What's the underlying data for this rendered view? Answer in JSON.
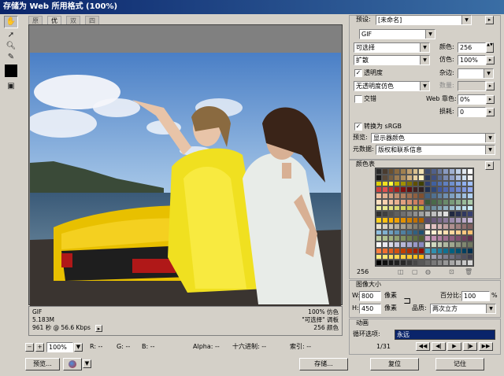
{
  "window": {
    "title": "存储为 Web 所用格式 (100%)"
  },
  "tabs": [
    {
      "label": "原稿"
    },
    {
      "label": "优化"
    },
    {
      "label": "双联"
    },
    {
      "label": "四联"
    }
  ],
  "info_left": {
    "format": "GIF",
    "size": "5.183M",
    "time": "961 秒 @ 56.6 Kbps"
  },
  "info_right": {
    "dither": "100% 仿色",
    "palette": "\"可选择\" 调板",
    "colors": "256 颜色"
  },
  "status": {
    "zoom": "100%",
    "r": "R: --",
    "g": "G: --",
    "b": "B: --",
    "alpha": "Alpha: --",
    "hex": "十六进制: --",
    "index": "索引: --"
  },
  "bottom": {
    "preview": "预览...",
    "save": "存储...",
    "reset": "复位",
    "remember": "记住"
  },
  "settings": {
    "preset_label": "预设:",
    "preset": "[未命名]",
    "format": "GIF",
    "reduction": "可选择",
    "colors_label": "颜色:",
    "colors": "256",
    "dither_algo": "扩散",
    "dither_label": "仿色:",
    "dither": "100%",
    "transparency": "透明度",
    "matte_label": "杂边:",
    "trans_dither": "无透明度仿色",
    "amount_label": "数量:",
    "interlace": "交错",
    "websnap_label": "Web 靠色:",
    "websnap": "0%",
    "lossy_label": "损耗:",
    "lossy": "0",
    "srgb": "转换为 sRGB",
    "preview_label": "预览:",
    "preview": "显示器颜色",
    "metadata_label": "元数据:",
    "metadata": "版权和联系信息"
  },
  "color_table": {
    "title": "颜色表",
    "count": "256"
  },
  "image_size": {
    "title": "图像大小",
    "w_label": "W:",
    "w": "800",
    "h_label": "H:",
    "h": "450",
    "unit": "像素",
    "percent_label": "百分比:",
    "percent": "100",
    "percent_unit": "%",
    "quality_label": "品质:",
    "quality": "两次立方"
  },
  "animation": {
    "title": "动画",
    "loop_label": "循环选项:",
    "loop": "永远",
    "frame": "1/31"
  },
  "palette_colors": [
    "#2a2a2a",
    "#4a3c30",
    "#6a5030",
    "#8a6a40",
    "#a08050",
    "#c0a070",
    "#d8c090",
    "#f0e0b0",
    "#3c4a6a",
    "#50608a",
    "#6a7aa0",
    "#8a9ac0",
    "#a0b0d0",
    "#c0d0e8",
    "#e0e8f0",
    "#ffffff",
    "#1a1a1a",
    "#5a4a3a",
    "#7a6040",
    "#9a7a50",
    "#b09060",
    "#d0b080",
    "#e8d0a0",
    "#fff0c0",
    "#2a3a5a",
    "#405080",
    "#5a6a90",
    "#7a8ab0",
    "#90a0c8",
    "#b0c0e0",
    "#d0e0f0",
    "#f0f0f0",
    "#e0d000",
    "#f0e020",
    "#ffff40",
    "#c8b800",
    "#a09000",
    "#807000",
    "#605000",
    "#404000",
    "#304070",
    "#4060a0",
    "#5070b0",
    "#6080c0",
    "#7090d0",
    "#80a0e0",
    "#90b0f0",
    "#a0c0ff",
    "#d04040",
    "#e05050",
    "#c03030",
    "#a02020",
    "#801010",
    "#601010",
    "#402020",
    "#302020",
    "#203050",
    "#304878",
    "#4058a0",
    "#5068b0",
    "#6078c0",
    "#7088d0",
    "#8098e0",
    "#90a8f0",
    "#f0c0a0",
    "#e0b090",
    "#d0a080",
    "#c09070",
    "#b08060",
    "#a07050",
    "#906040",
    "#805030",
    "#406080",
    "#507090",
    "#6080a0",
    "#7090b0",
    "#80a0c0",
    "#90b0d0",
    "#a0c0e0",
    "#b0d0f0",
    "#ffe0c0",
    "#f8d0b0",
    "#f0c0a0",
    "#e8b090",
    "#e0a080",
    "#d89070",
    "#d08060",
    "#c87050",
    "#3a5a3a",
    "#4a6a4a",
    "#5a7a5a",
    "#6a8a6a",
    "#7a9a7a",
    "#8aaa8a",
    "#9aba9a",
    "#aacaaa",
    "#f0f0a0",
    "#e8e890",
    "#e0e080",
    "#d8d870",
    "#d0d060",
    "#c8c850",
    "#c0c040",
    "#b8b830",
    "#608090",
    "#7090a0",
    "#80a0b0",
    "#90b0c0",
    "#a0c0d0",
    "#b0d0e0",
    "#c0e0f0",
    "#d0f0ff",
    "#303030",
    "#404040",
    "#505050",
    "#606060",
    "#707070",
    "#808080",
    "#909090",
    "#a0a0a0",
    "#b0b0b0",
    "#c0c0c0",
    "#d0d0d0",
    "#e0e0e0",
    "#202840",
    "#283050",
    "#303860",
    "#384070",
    "#ffd020",
    "#ffc010",
    "#ffb000",
    "#f0a000",
    "#e09000",
    "#d08000",
    "#c07000",
    "#b06000",
    "#5a4a6a",
    "#6a5a7a",
    "#7a6a8a",
    "#8a7a9a",
    "#9a8aaa",
    "#aa9aba",
    "#baaaca",
    "#cabada",
    "#e8e0d0",
    "#d8d0c0",
    "#c8c0b0",
    "#b8b0a0",
    "#a8a090",
    "#989080",
    "#888070",
    "#787060",
    "#f0d0d0",
    "#e0c0c0",
    "#d0b0b0",
    "#c0a0a0",
    "#b09090",
    "#a08080",
    "#907070",
    "#806060",
    "#90c0e0",
    "#80b0d0",
    "#70a0c0",
    "#6090b0",
    "#5080a0",
    "#407090",
    "#306080",
    "#205070",
    "#fff8e0",
    "#fff0d0",
    "#ffe8c0",
    "#ffe0b0",
    "#ffd8a0",
    "#ffd090",
    "#ffc880",
    "#ffc070",
    "#c0d0a0",
    "#b0c090",
    "#a0b080",
    "#90a070",
    "#809060",
    "#708050",
    "#607040",
    "#506030",
    "#d0a0c0",
    "#c090b0",
    "#b080a0",
    "#a07090",
    "#906080",
    "#805070",
    "#704060",
    "#603050",
    "#f8f8f8",
    "#e8e8f0",
    "#d8d8e8",
    "#c8c8e0",
    "#b8b8d8",
    "#a8a8d0",
    "#9898c8",
    "#8888c0",
    "#e0e8d0",
    "#d0d8c0",
    "#c0c8b0",
    "#b0b8a0",
    "#a0a890",
    "#909880",
    "#808870",
    "#707860",
    "#ff8040",
    "#f07030",
    "#e06020",
    "#d05010",
    "#c04000",
    "#b03000",
    "#a02000",
    "#901000",
    "#40a0c0",
    "#3090b0",
    "#2080a0",
    "#107090",
    "#006080",
    "#005070",
    "#004060",
    "#003050",
    "#fff080",
    "#ffe870",
    "#ffe060",
    "#ffd850",
    "#ffd040",
    "#ffc830",
    "#ffc020",
    "#ffb810",
    "#b0b0c0",
    "#a0a0b0",
    "#9090a0",
    "#808090",
    "#707080",
    "#606070",
    "#505060",
    "#404050",
    "#000000",
    "#101010",
    "#181818",
    "#202020",
    "#282828",
    "#383838",
    "#484848",
    "#585858",
    "#686868",
    "#787878",
    "#888888",
    "#989898",
    "#a8a8a8",
    "#b8b8b8",
    "#c8c8c8",
    "#d8d8d8"
  ]
}
